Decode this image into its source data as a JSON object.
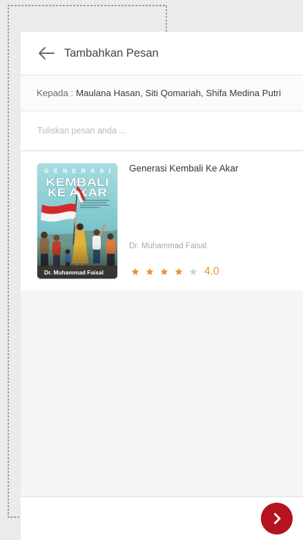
{
  "header": {
    "title": "Tambahkan Pesan",
    "back_icon": "arrow-left-icon"
  },
  "recipients": {
    "label": "Kepada :",
    "names": "Maulana Hasan, Siti Qomariah, Shifa Medina Putri"
  },
  "message": {
    "placeholder": "Tuliskan pesan anda ..."
  },
  "book": {
    "title": "Generasi Kembali Ke Akar",
    "author": "Dr. Muhammad Faisal",
    "rating": "4.0",
    "stars_filled": 4,
    "stars_total": 5,
    "cover": {
      "title_line_1": "GENERASI",
      "title_line_2": "KEMBALI",
      "title_line_3": "KE AKAR",
      "author": "Dr. Muhammad Faisal"
    }
  },
  "footer": {
    "next_icon": "chevron-right-icon"
  },
  "colors": {
    "accent_orange": "#f2932a",
    "star_empty": "#d3d3d3",
    "primary_red": "#b3141d"
  }
}
